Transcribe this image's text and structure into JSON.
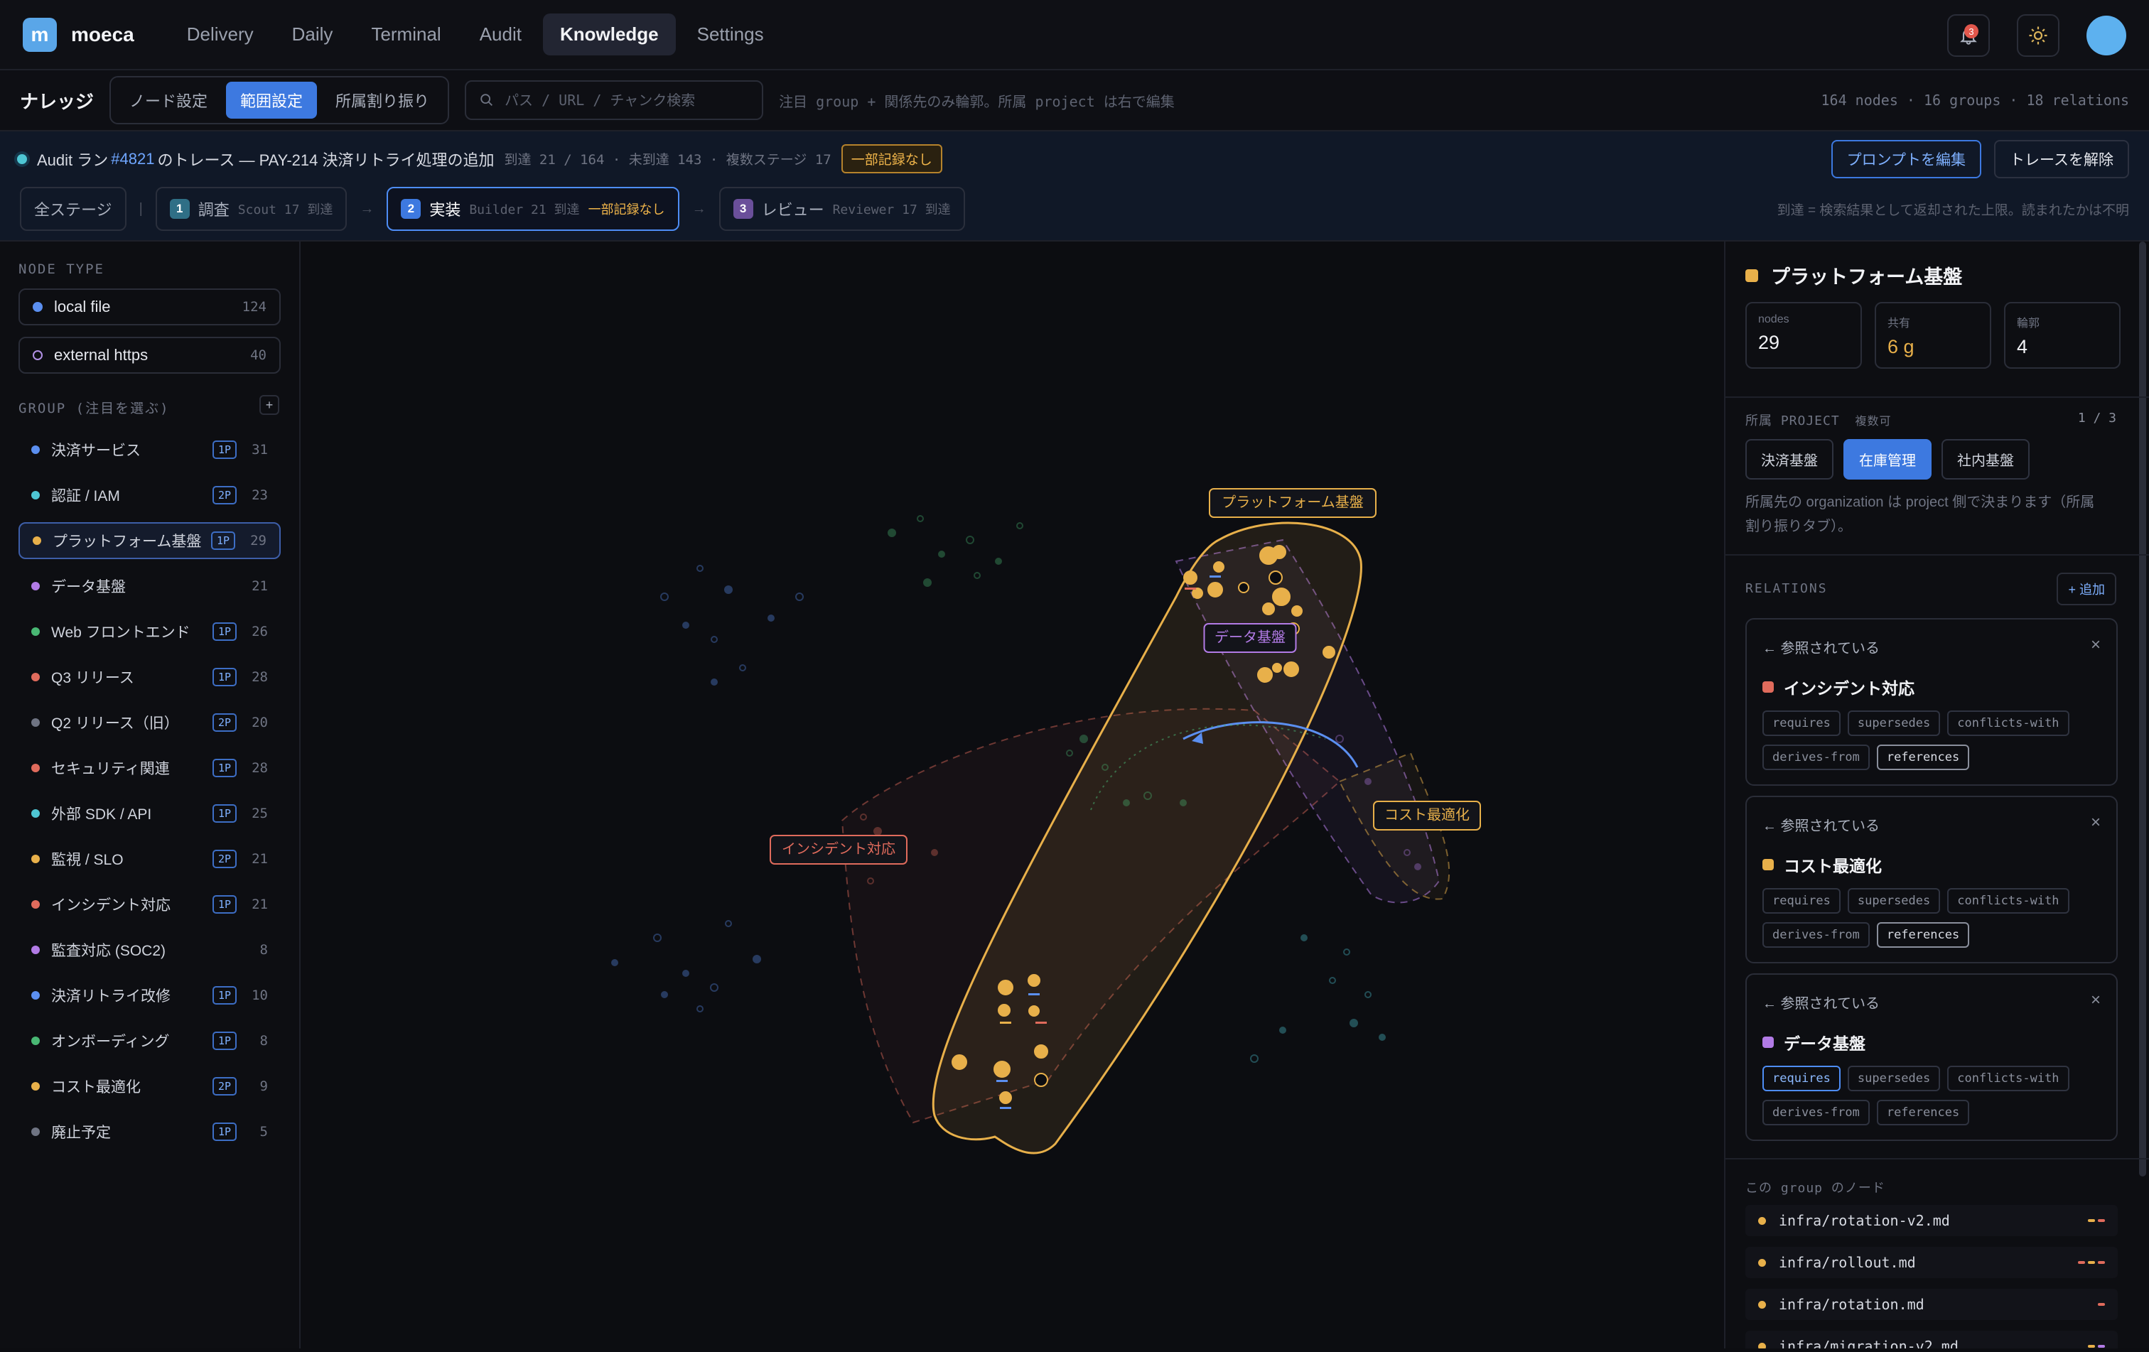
{
  "app": {
    "logo_letter": "m",
    "name": "moeca"
  },
  "nav": {
    "tabs": [
      "Delivery",
      "Daily",
      "Terminal",
      "Audit",
      "Knowledge",
      "Settings"
    ],
    "active": "Knowledge"
  },
  "notifications": {
    "count": "3"
  },
  "toolbar": {
    "title": "ナレッジ",
    "segments": [
      "ノード設定",
      "範囲設定",
      "所属割り振り"
    ],
    "active_segment": "範囲設定",
    "search_placeholder": "パス / URL / チャンク検索",
    "hint": "注目 group + 関係先のみ輪郭。所属 project は右で編集",
    "stats": "164 nodes · 16 groups · 18 relations"
  },
  "audit": {
    "prefix": "Audit ラン",
    "run_id": "#4821",
    "title": "のトレース — PAY-214 決済リトライ処理の追加",
    "reach": "到達 21 / 164 · 未到達 143 · 複数ステージ 17",
    "warning": "一部記録なし",
    "edit_prompt": "プロンプトを編集",
    "clear_trace": "トレースを解除",
    "all_stages": "全ステージ",
    "stages": [
      {
        "num": "1",
        "name": "調査",
        "meta": "Scout 17 到達",
        "warn": "",
        "color": "#2f6f86"
      },
      {
        "num": "2",
        "name": "実装",
        "meta": "Builder 21 到達",
        "warn": "一部記録なし",
        "color": "#3d79e0"
      },
      {
        "num": "3",
        "name": "レビュー",
        "meta": "Reviewer 17 到達",
        "warn": "",
        "color": "#6a4f9a"
      }
    ],
    "note": "到達 = 検索結果として返却された上限。読まれたかは不明"
  },
  "sidebar": {
    "node_type_header": "NODE TYPE",
    "node_types": [
      {
        "label": "local file",
        "count": "124",
        "color": "#5b8ff0"
      },
      {
        "label": "external https",
        "count": "40",
        "color": "#b291e6"
      }
    ],
    "group_header": "GROUP (注目を選ぶ)",
    "add_label": "+",
    "groups": [
      {
        "label": "決済サービス",
        "tag": "1P",
        "count": "31",
        "color": "#5b8ff0"
      },
      {
        "label": "認証 / IAM",
        "tag": "2P",
        "count": "23",
        "color": "#4ec6d4"
      },
      {
        "label": "プラットフォーム基盤",
        "tag": "1P",
        "count": "29",
        "color": "#e8b04a"
      },
      {
        "label": "データ基盤",
        "tag": "",
        "count": "21",
        "color": "#b27be6"
      },
      {
        "label": "Web フロントエンド",
        "tag": "1P",
        "count": "26",
        "color": "#49b874"
      },
      {
        "label": "Q3 リリース",
        "tag": "1P",
        "count": "28",
        "color": "#e06b5c"
      },
      {
        "label": "Q2 リリース（旧）",
        "tag": "2P",
        "count": "20",
        "color": "#6f7483"
      },
      {
        "label": "セキュリティ関連",
        "tag": "1P",
        "count": "28",
        "color": "#e06b5c"
      },
      {
        "label": "外部 SDK / API",
        "tag": "1P",
        "count": "25",
        "color": "#4ec6d4"
      },
      {
        "label": "監視 / SLO",
        "tag": "2P",
        "count": "21",
        "color": "#e8b04a"
      },
      {
        "label": "インシデント対応",
        "tag": "1P",
        "count": "21",
        "color": "#e06b5c"
      },
      {
        "label": "監査対応 (SOC2)",
        "tag": "",
        "count": "8",
        "color": "#b27be6"
      },
      {
        "label": "決済リトライ改修",
        "tag": "1P",
        "count": "10",
        "color": "#5b8ff0"
      },
      {
        "label": "オンボーディング",
        "tag": "1P",
        "count": "8",
        "color": "#49b874"
      },
      {
        "label": "コスト最適化",
        "tag": "2P",
        "count": "9",
        "color": "#e8b04a"
      },
      {
        "label": "廃止予定",
        "tag": "1P",
        "count": "5",
        "color": "#6f7483"
      }
    ],
    "active_group": "プラットフォーム基盤"
  },
  "canvas": {
    "labels": {
      "platform": "プラットフォーム基盤",
      "data": "データ基盤",
      "incident": "インシデント対応",
      "cost": "コスト最適化"
    },
    "colors": {
      "platform": "#e8b04a",
      "data": "#b27be6",
      "incident": "#e06b5c",
      "cost": "#e8b04a",
      "edge": "#5b8ff0"
    }
  },
  "panel": {
    "title": "プラットフォーム基盤",
    "color": "#e8b04a",
    "stats": [
      {
        "label": "nodes",
        "value": "29"
      },
      {
        "label": "共有",
        "value": "6 g"
      },
      {
        "label": "輪郭",
        "value": "4"
      }
    ],
    "project_header": "所属 PROJECT",
    "project_sub": "複数可",
    "project_count": "1 / 3",
    "projects": [
      "決済基盤",
      "在庫管理",
      "社内基盤"
    ],
    "active_project": "在庫管理",
    "project_note_1": "所属先の organization は project 側で決まります（所属",
    "project_note_2": "割り振りタブ）。",
    "relations_header": "RELATIONS",
    "add_relation": "+ 追加",
    "relations": [
      {
        "direction": "← 参照されている",
        "target": "インシデント対応",
        "color": "#e06b5c",
        "types": [
          "requires",
          "supersedes",
          "conflicts-with",
          "derives-from",
          "references"
        ],
        "selected": "references"
      },
      {
        "direction": "← 参照されている",
        "target": "コスト最適化",
        "color": "#e8b04a",
        "types": [
          "requires",
          "supersedes",
          "conflicts-with",
          "derives-from",
          "references"
        ],
        "selected": "references"
      },
      {
        "direction": "← 参照されている",
        "target": "データ基盤",
        "color": "#b27be6",
        "types": [
          "requires",
          "supersedes",
          "conflicts-with",
          "derives-from",
          "references"
        ],
        "selected": "requires"
      }
    ],
    "nodes_header": "この group のノード",
    "nodes": [
      "infra/rotation-v2.md",
      "infra/rollout.md",
      "infra/rotation.md",
      "infra/migration-v2.md"
    ]
  }
}
